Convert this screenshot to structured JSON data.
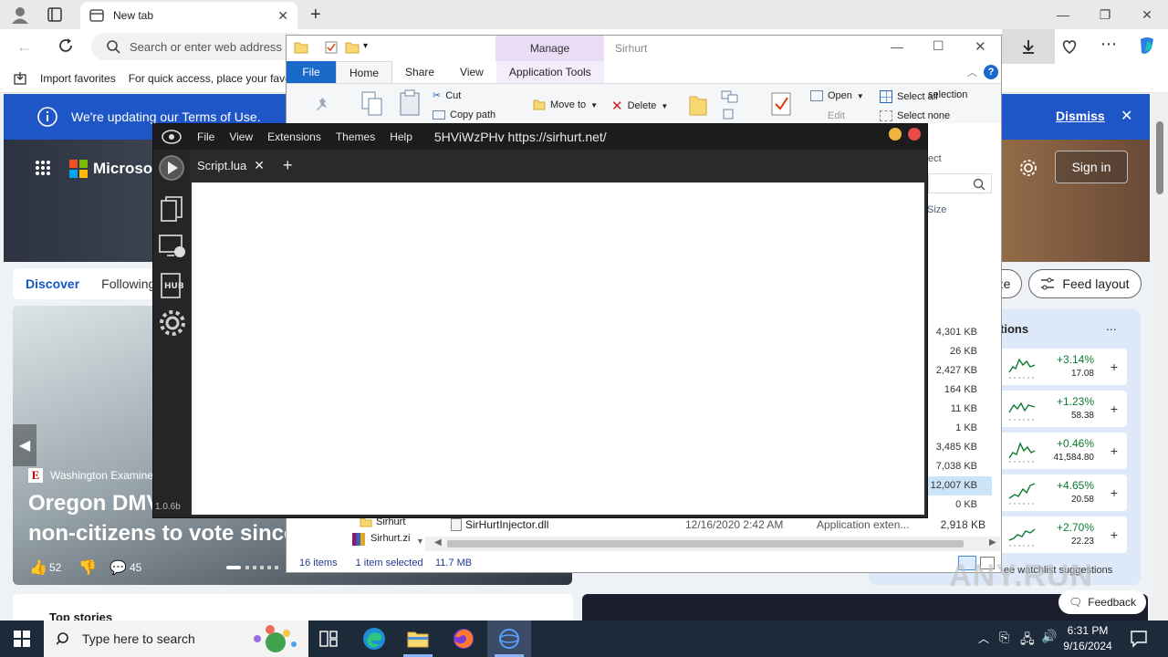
{
  "edge": {
    "tab_title": "New tab",
    "address_placeholder": "Search or enter web address",
    "favorites": {
      "import": "Import favorites",
      "hint": "For quick access, place your favorites"
    },
    "infobar": {
      "text": "We're updating our Terms of Use.",
      "dismiss": "Dismiss"
    },
    "hero": {
      "brand": "Microsoft",
      "sign_in": "Sign in"
    },
    "feed": {
      "tabs": [
        "Discover",
        "Following"
      ],
      "personalize_partial": "ze",
      "feed_layout": "Feed layout"
    },
    "story": {
      "source": "Washington Examiner",
      "headline_line1": "Oregon DMV",
      "headline_line2": "non-citizens to vote since",
      "likes": "52",
      "comments": "45"
    },
    "watchlist": {
      "title_partial": "tions",
      "more": "...",
      "rows": [
        {
          "pct": "+3.14%",
          "value": "17.08"
        },
        {
          "pct": "+1.23%",
          "value": "58.38"
        },
        {
          "pct": "+0.46%",
          "value": "41,584.80"
        },
        {
          "pct": "+4.65%",
          "value": "20.58"
        },
        {
          "pct": "+2.70%",
          "value": "22.23"
        }
      ],
      "footer_partial": "ee watchlist suggestions"
    },
    "top_stories_partial": "Top stories",
    "feedback": "Feedback",
    "colors": {
      "infobar": "#1f56c7",
      "accent": "#1556c7",
      "gain": "#0b7a30"
    }
  },
  "explorer": {
    "manage": "Manage",
    "title": "Sirhurt",
    "tabs": {
      "file": "File",
      "home": "Home",
      "share": "Share",
      "view": "View",
      "app_tools": "Application Tools"
    },
    "ribbon": {
      "cut": "Cut",
      "copy_path": "Copy path",
      "move_to": "Move to",
      "delete": "Delete",
      "open": "Open",
      "edit": "Edit",
      "select_all": "Select all",
      "select_none": "Select none",
      "invert_partial": "selection",
      "select_partial": "ect"
    },
    "size_header": "Size",
    "sizes": [
      "4,301 KB",
      "26 KB",
      "2,427 KB",
      "164 KB",
      "11 KB",
      "1 KB",
      "3,485 KB",
      "7,038 KB",
      "12,007 KB",
      "0 KB"
    ],
    "selected_row": {
      "name": "SirHurtInjector.dll",
      "date": "12/16/2020 2:42 AM",
      "type": "Application exten...",
      "size": "2,918 KB"
    },
    "nav": {
      "folder_partial": "Sirhurt",
      "zip_partial": "Sirhurt.zi"
    },
    "status": {
      "items": "16 items",
      "selected": "1 item selected",
      "size": "11.7 MB"
    }
  },
  "sirhurt": {
    "menu": [
      "File",
      "View",
      "Extensions",
      "Themes",
      "Help"
    ],
    "title": "5HViWzPHv https://sirhurt.net/",
    "tab": "Script.lua",
    "version": "1.0.6b",
    "colors": {
      "minimize": "#f0b43c",
      "close": "#e84a4a"
    }
  },
  "taskbar": {
    "search_placeholder": "Type here to search",
    "time": "6:31 PM",
    "date": "9/16/2024"
  },
  "watermark": "ANY.RUN"
}
